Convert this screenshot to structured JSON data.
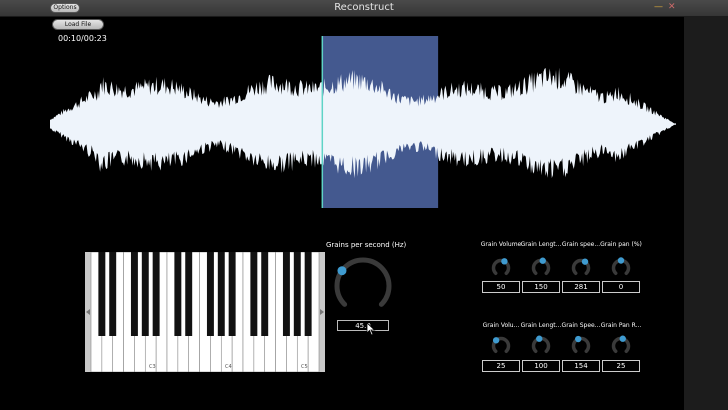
{
  "window": {
    "title": "Reconstruct",
    "options_label": "Options"
  },
  "toolbar": {
    "load_label": "Load File"
  },
  "player": {
    "timecode": "00:10/00:23"
  },
  "grains": {
    "label": "Grains per second (Hz)",
    "value": "45.0",
    "knob_level": 0.3
  },
  "keyboard": {
    "labels": [
      "C3",
      "C4",
      "C5"
    ]
  },
  "selection": {
    "start_fraction": 0.435,
    "end_fraction": 0.62,
    "playhead_fraction": 0.435
  },
  "knobs_row1": [
    {
      "label": "Grain Volume",
      "value": "50",
      "level": 0.6
    },
    {
      "label": "Grain Lengt...",
      "value": "150",
      "level": 0.55
    },
    {
      "label": "Grain spee...",
      "value": "281",
      "level": 0.62
    },
    {
      "label": "Grain pan (%)",
      "value": "0",
      "level": 0.5
    }
  ],
  "knobs_row2": [
    {
      "label": "Grain Volu...",
      "value": "25",
      "level": 0.35
    },
    {
      "label": "Grain Lengt...",
      "value": "100",
      "level": 0.45
    },
    {
      "label": "Grain Spee...",
      "value": "154",
      "level": 0.42
    },
    {
      "label": "Grain Pan R...",
      "value": "25",
      "level": 0.55
    }
  ],
  "colors": {
    "accent": "#3f9bd0",
    "selection": "#44598f",
    "playhead": "#5fd3c6",
    "wave": "#eef4fb"
  }
}
